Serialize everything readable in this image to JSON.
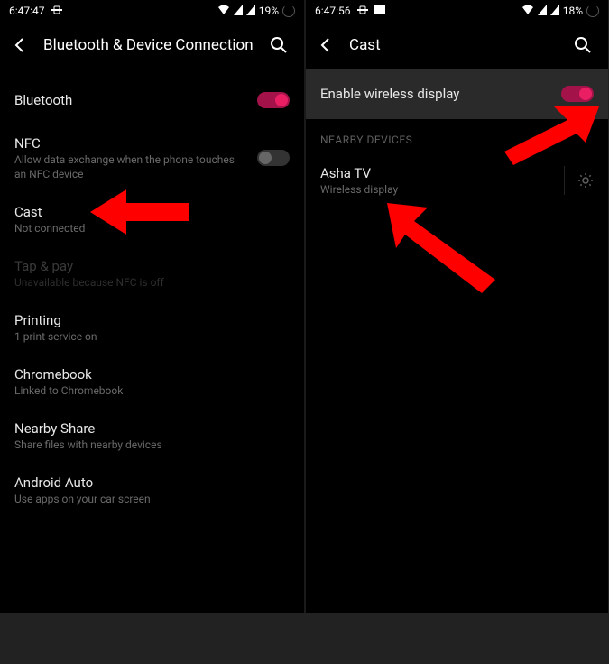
{
  "left": {
    "status": {
      "time": "6:47:47",
      "battery": "19%"
    },
    "title": "Bluetooth & Device Connection",
    "items": [
      {
        "title": "Bluetooth",
        "sub": "",
        "toggle": "on"
      },
      {
        "title": "NFC",
        "sub": "Allow data exchange when the phone touches an NFC device",
        "toggle": "off"
      },
      {
        "title": "Cast",
        "sub": "Not connected"
      },
      {
        "title": "Tap & pay",
        "sub": "Unavailable because NFC is off",
        "disabled": true
      },
      {
        "title": "Printing",
        "sub": "1 print service on"
      },
      {
        "title": "Chromebook",
        "sub": "Linked to Chromebook"
      },
      {
        "title": "Nearby Share",
        "sub": "Share files with nearby devices"
      },
      {
        "title": "Android Auto",
        "sub": "Use apps on your car screen"
      }
    ]
  },
  "right": {
    "status": {
      "time": "6:47:56",
      "battery": "18%"
    },
    "title": "Cast",
    "enable_label": "Enable wireless display",
    "section": "NEARBY DEVICES",
    "devices": [
      {
        "title": "Asha TV",
        "sub": "Wireless display"
      }
    ]
  }
}
